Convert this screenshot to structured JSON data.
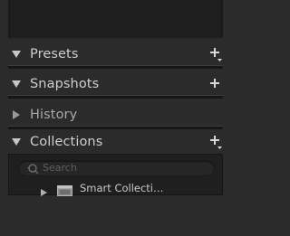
{
  "panels": [
    {
      "title": "Presets",
      "expanded": true,
      "has_add": true,
      "add_has_menu": true
    },
    {
      "title": "Snapshots",
      "expanded": true,
      "has_add": true,
      "add_has_menu": false
    },
    {
      "title": "History",
      "expanded": false,
      "has_add": false
    },
    {
      "title": "Collections",
      "expanded": true,
      "has_add": true,
      "add_has_menu": true
    }
  ],
  "collections": {
    "search_placeholder": "Search",
    "items": [
      {
        "label": "Smart Collecti…",
        "icon": "smart-collection-set-icon",
        "expanded": false
      }
    ]
  },
  "colors": {
    "background": "#2b2b2b",
    "panel_fill": "#1f1f1f",
    "header_text": "#cfcfcf"
  }
}
